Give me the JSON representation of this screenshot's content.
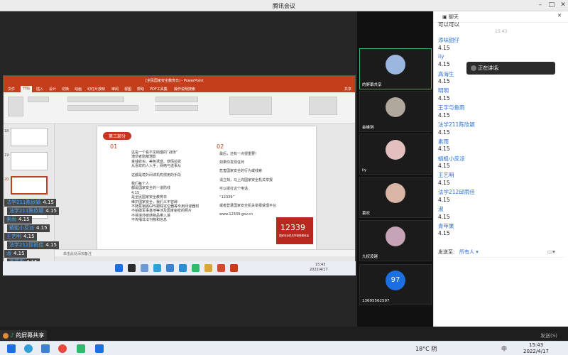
{
  "window": {
    "title": "腾讯会议"
  },
  "ppt": {
    "title": "[全民国家安全教育日] - PowerPoint",
    "tabs": [
      "文件",
      "开始",
      "插入",
      "设计",
      "切换",
      "动画",
      "幻灯片放映",
      "审阅",
      "视图",
      "帮助",
      "PDF工具集",
      "操作说明搜索"
    ],
    "share_btn": "共享",
    "slide_numbers": [
      "18",
      "19",
      "20",
      "21"
    ],
    "notes_placeholder": "单击此处添加备注",
    "status_left": "幻灯片 第20张，共25张",
    "status_lang": "中文(中国)",
    "status_acc": "辅助功能: 调查",
    "status_notes": "备注",
    "status_comments": "批注",
    "zoom": "62%"
  },
  "slide": {
    "section_badge": "第三部分",
    "num1": "01",
    "num2": "02",
    "col1": [
      "这是一个看不见硝烟的“战场”",
      "潜伏者隐蔽潜影",
      "金钱收买、美色诱惑、感情拉拢",
      "从喜欢的人入手，网络与送事从",
      "",
      "这都是境外间谍机构惯用的手段",
      "",
      "我们每个人",
      "都是国家安全的一道防线",
      "4.15",
      "是全民国家安全教育日",
      "维护国家安全，我们义不容辞",
      "不随意销毁GPS跟踪定位器等专用间谍器材",
      "不拍摄军事基地等涉及国家秘密的照片",
      "不将境外敏感物品带入境",
      "不传播非法刊物和信息"
    ],
    "col2": [
      "最后，还有一点很重要!",
      "",
      "如果你发现任何",
      "",
      "危害国家安全的行为或线索",
      "",
      "请立刻，马上向国家安全机关举报",
      "",
      "可以拨打这个电话",
      "",
      "“12339”",
      "",
      "或者登录国家安全机关举报受理平台",
      "",
      "www.12339.gov.cn"
    ],
    "poster_number": "12339",
    "poster_caption": "国家安全机关举报受理电话"
  },
  "danmu": [
    {
      "name": "法学211陈欣颖",
      "text": "4.15"
    },
    {
      "name": "法学211陈欣颖",
      "text": "4.15"
    },
    {
      "name": "素雨",
      "text": "4.15"
    },
    {
      "name": "蜻蜓小反派",
      "text": "4.15"
    },
    {
      "name": "王艺明",
      "text": "4.15"
    },
    {
      "name": "法学212邱雨佳",
      "text": "4.15"
    },
    {
      "name": "淑",
      "text": "4.15"
    },
    {
      "name": "青苹果",
      "text": "4.15"
    }
  ],
  "share_label": "的屏幕共享",
  "shared_taskbar": {
    "weather": "15:43",
    "date": "2022/4/17"
  },
  "videos": [
    {
      "name": "的屏幕共享",
      "color": "#9bb7e0",
      "active": true
    },
    {
      "name": "金峰琪",
      "color": "#b0a89c",
      "active": false
    },
    {
      "name": "iiy",
      "color": "#e3c0c0",
      "active": false
    },
    {
      "name": "慕欢",
      "color": "#d8b5a5",
      "active": false
    },
    {
      "name": "九权凌越",
      "color": "#c6a4b8",
      "active": false
    },
    {
      "name": "13695562597",
      "color": "#1c6fe0",
      "active": false,
      "initials": "97"
    }
  ],
  "chat": {
    "header": "聊天",
    "top_msg": "可以可以",
    "time": "15:43",
    "messages": [
      {
        "name": "添味甜仔",
        "text": "4.15"
      },
      {
        "name": "iiy",
        "text": "4.15"
      },
      {
        "name": "高海生",
        "text": "4.15"
      },
      {
        "name": "明明",
        "text": "4.15"
      },
      {
        "name": "王宇与鱼雨",
        "text": "4.15"
      },
      {
        "name": "法学211陈欣颖",
        "text": "4.15"
      },
      {
        "name": "素雨",
        "text": "4.15"
      },
      {
        "name": "蜻蜓小反派",
        "text": "4.15"
      },
      {
        "name": "王艺明",
        "text": "4.15"
      },
      {
        "name": "法学212邱雨佳",
        "text": "4.15"
      },
      {
        "name": "淑",
        "text": "4.15"
      },
      {
        "name": "青苹果",
        "text": "4.15"
      }
    ],
    "send_to_label": "发送至:",
    "send_to_value": "所有人",
    "send_btn": "发送(S)"
  },
  "speaking": "正在讲话:",
  "taskbar": {
    "weather": "18°C 阴",
    "ime": "中",
    "time": "15:43",
    "date": "2022/4/17"
  }
}
